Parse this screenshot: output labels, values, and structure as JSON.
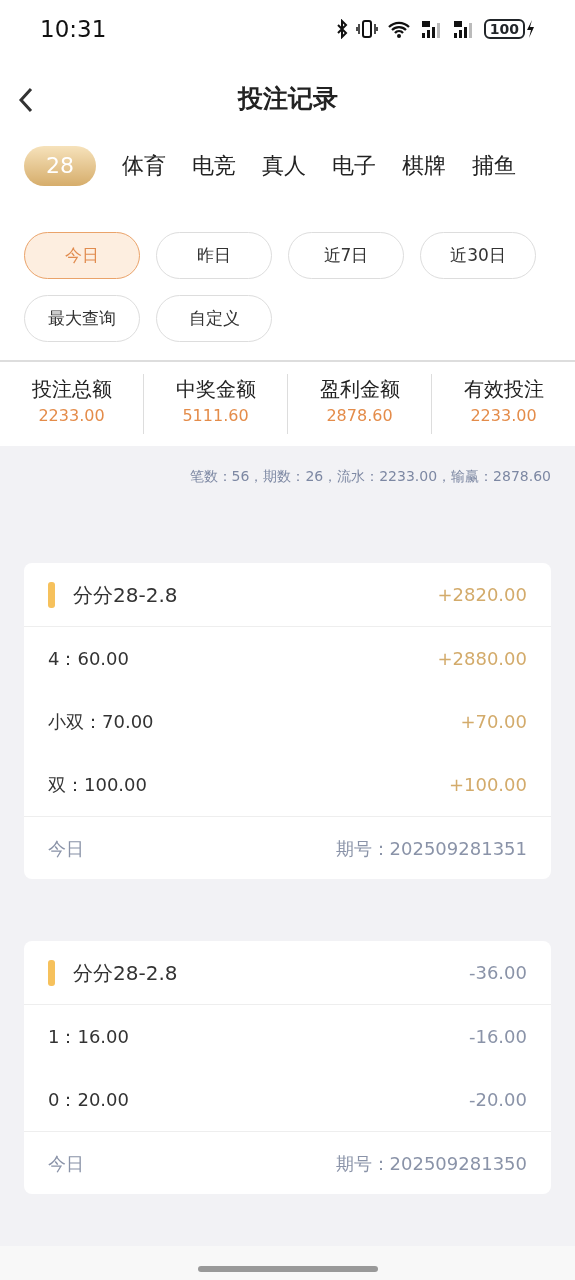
{
  "status_bar": {
    "time": "10:31",
    "battery": "100"
  },
  "header": {
    "title": "投注记录"
  },
  "categories": [
    {
      "label": "28",
      "selected": true
    },
    {
      "label": "体育",
      "selected": false
    },
    {
      "label": "电竞",
      "selected": false
    },
    {
      "label": "真人",
      "selected": false
    },
    {
      "label": "电子",
      "selected": false
    },
    {
      "label": "棋牌",
      "selected": false
    },
    {
      "label": "捕鱼",
      "selected": false
    }
  ],
  "date_filters": [
    {
      "label": "今日",
      "selected": true
    },
    {
      "label": "昨日",
      "selected": false
    },
    {
      "label": "近7日",
      "selected": false
    },
    {
      "label": "近30日",
      "selected": false
    },
    {
      "label": "最大查询",
      "selected": false
    },
    {
      "label": "自定义",
      "selected": false
    }
  ],
  "stats": [
    {
      "label": "投注总额",
      "value": "2233.00"
    },
    {
      "label": "中奖金额",
      "value": "5111.60"
    },
    {
      "label": "盈利金额",
      "value": "2878.60"
    },
    {
      "label": "有效投注",
      "value": "2233.00"
    }
  ],
  "summary": "笔数：56，期数：26，流水：2233.00，输赢：2878.60",
  "records": [
    {
      "title": "分分28-2.8",
      "total": "+2820.00",
      "kind": "win",
      "bets": [
        {
          "label": "4：60.00",
          "amount": "+2880.00",
          "kind": "win"
        },
        {
          "label": "小双：70.00",
          "amount": "+70.00",
          "kind": "win"
        },
        {
          "label": "双：100.00",
          "amount": "+100.00",
          "kind": "win"
        }
      ],
      "date": "今日",
      "period": "期号：202509281351"
    },
    {
      "title": "分分28-2.8",
      "total": "-36.00",
      "kind": "loss",
      "bets": [
        {
          "label": "1：16.00",
          "amount": "-16.00",
          "kind": "loss"
        },
        {
          "label": "0：20.00",
          "amount": "-20.00",
          "kind": "loss"
        }
      ],
      "date": "今日",
      "period": "期号：202509281350"
    }
  ]
}
